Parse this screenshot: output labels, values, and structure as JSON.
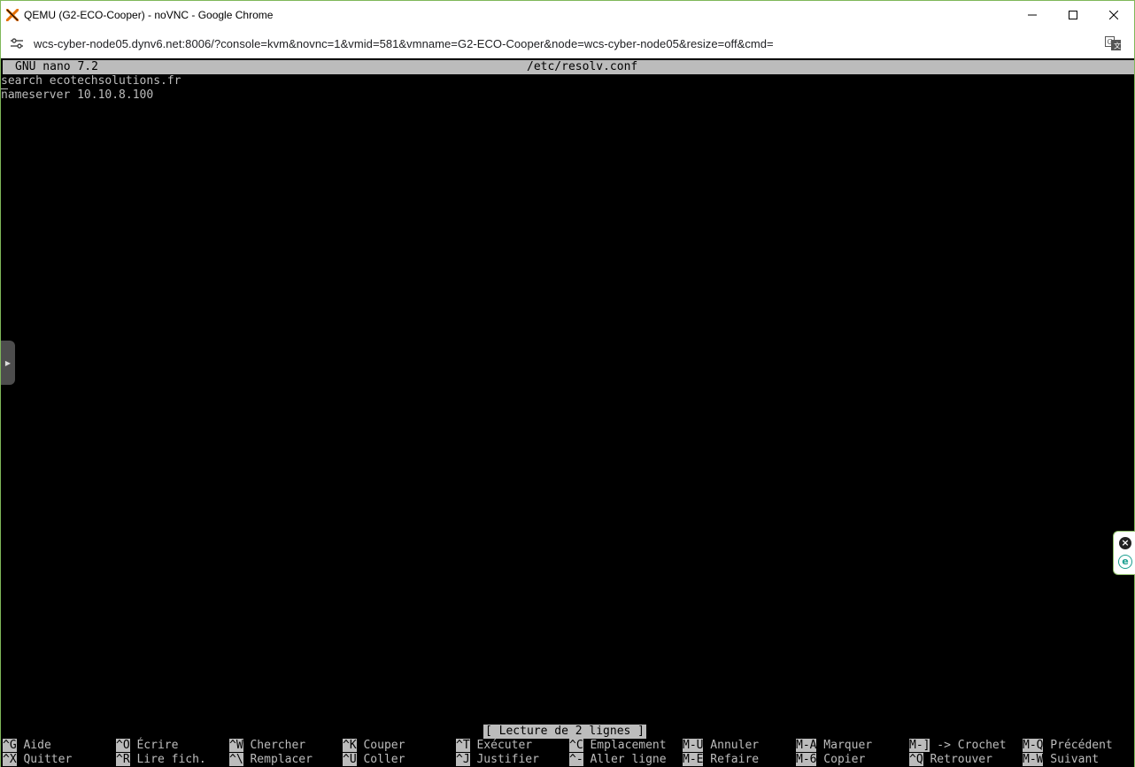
{
  "window": {
    "title": "QEMU (G2-ECO-Cooper) - noVNC - Google Chrome",
    "minimize_label": "─",
    "maximize_label": "☐",
    "close_label": "✕"
  },
  "browser": {
    "url": "wcs-cyber-node05.dynv6.net:8006/?console=kvm&novnc=1&vmid=581&vmname=G2-ECO-Cooper&node=wcs-cyber-node05&resize=off&cmd="
  },
  "nano": {
    "version_label": "GNU nano 7.2",
    "filename": "/etc/resolv.conf",
    "lines": [
      {
        "first_char": "s",
        "rest": "earch ecotechsolutions.fr"
      },
      {
        "first_char": "",
        "rest": "nameserver 10.10.8.100"
      }
    ],
    "status_message": "[ Lecture de 2 lignes ]",
    "shortcuts_row1": [
      {
        "key": "^G",
        "label": " Aide"
      },
      {
        "key": "^O",
        "label": " Écrire"
      },
      {
        "key": "^W",
        "label": " Chercher"
      },
      {
        "key": "^K",
        "label": " Couper"
      },
      {
        "key": "^T",
        "label": " Exécuter"
      },
      {
        "key": "^C",
        "label": " Emplacement"
      },
      {
        "key": "M-U",
        "label": " Annuler"
      },
      {
        "key": "M-A",
        "label": " Marquer"
      },
      {
        "key": "M-]",
        "label": " -> Crochet"
      },
      {
        "key": "M-Q",
        "label": " Précédent"
      }
    ],
    "shortcuts_row2": [
      {
        "key": "^X",
        "label": " Quitter"
      },
      {
        "key": "^R",
        "label": " Lire fich."
      },
      {
        "key": "^\\",
        "label": " Remplacer"
      },
      {
        "key": "^U",
        "label": " Coller"
      },
      {
        "key": "^J",
        "label": " Justifier"
      },
      {
        "key": "^-",
        "label": " Aller ligne"
      },
      {
        "key": "M-E",
        "label": " Refaire"
      },
      {
        "key": "M-6",
        "label": " Copier"
      },
      {
        "key": "^Q",
        "label": " Retrouver"
      },
      {
        "key": "M-W",
        "label": " Suivant"
      }
    ]
  },
  "colors": {
    "terminal_bg": "#000000",
    "terminal_fg": "#bcbcbc",
    "window_border": "#7fb85a"
  },
  "icons": {
    "app": "proxmox-x-icon",
    "site": "site-settings-icon",
    "translate": "translate-icon",
    "vnc_handle": "expand-arrow-icon",
    "ext_close": "close-circle-icon",
    "ext_logo": "e-logo-icon"
  }
}
